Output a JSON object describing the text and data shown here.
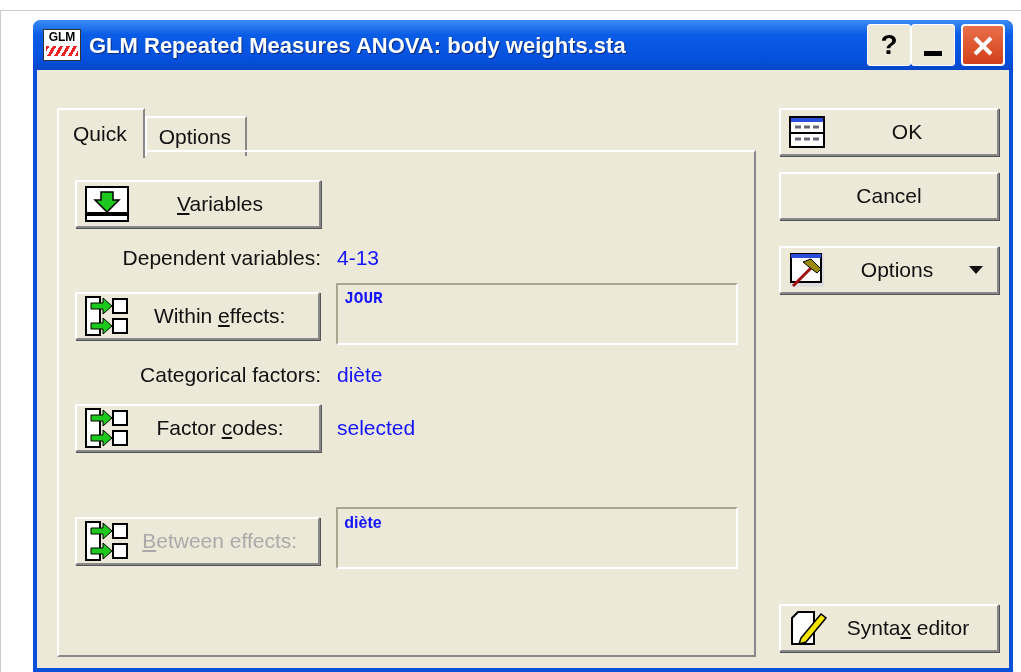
{
  "window": {
    "icon_text": "GLM",
    "title": "GLM Repeated Measures ANOVA: body weights.sta",
    "help": "?"
  },
  "tabs": [
    {
      "label": "Quick",
      "selected": true
    },
    {
      "label": "Options",
      "selected": false
    }
  ],
  "quick_panel": [
    {
      "kind": "variables",
      "access_key": "V",
      "label_after": "ariables",
      "disabled": false
    },
    {
      "kind": "info",
      "label": "Dependent variables:",
      "value": "4-13"
    },
    {
      "kind": "effects",
      "label_before": "Within ",
      "access_key": "e",
      "label_after": "ffects:",
      "disabled": false,
      "field": "JOUR"
    },
    {
      "kind": "info",
      "label": "Categorical factors:",
      "value": "diète"
    },
    {
      "kind": "effects",
      "label_before": "Factor ",
      "access_key": "c",
      "label_after": "odes:",
      "disabled": false,
      "value": "selected"
    },
    {
      "kind": "effects",
      "access_key": "B",
      "label_after": "etween effects:",
      "disabled": true,
      "field": "diète"
    }
  ],
  "side_buttons": [
    {
      "kind": "ok",
      "label": "OK"
    },
    {
      "kind": "cancel",
      "label": "Cancel"
    },
    {
      "kind": "options",
      "label": "Options"
    },
    {
      "kind": "syntax",
      "label_before": "Synta",
      "access_key": "x",
      "label_after": " editor"
    }
  ]
}
